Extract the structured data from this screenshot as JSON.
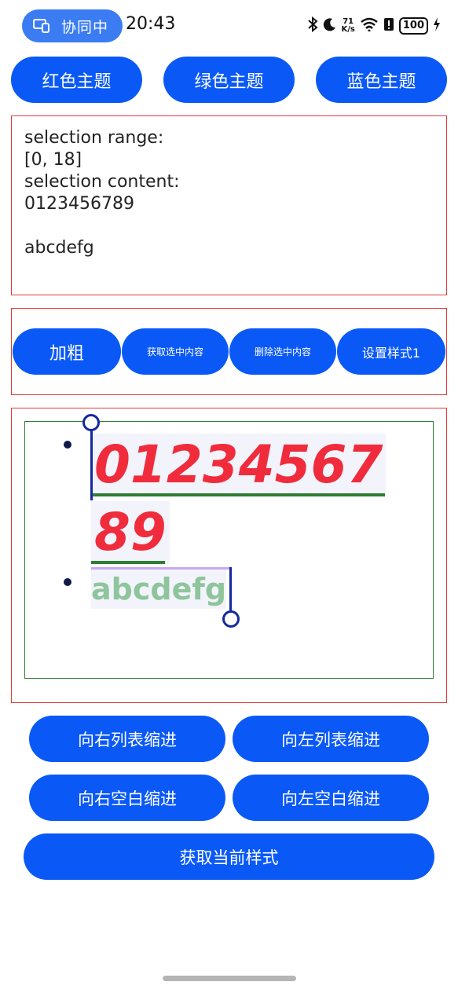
{
  "status_bar": {
    "collab_label": "协同中",
    "time": "20:43",
    "net_speed_value": "71",
    "net_speed_unit": "K/s",
    "battery": "100"
  },
  "theme_buttons": {
    "red": "红色主题",
    "green": "绿色主题",
    "blue": "蓝色主题"
  },
  "selection_info": {
    "text": "selection range:\n[0, 18]\nselection content:\n0123456789\n\nabcdefg"
  },
  "action_buttons": {
    "bold": "加粗",
    "get_selected": "获取选中内容",
    "delete_selected": "删除选中内容",
    "set_style": "设置样式1"
  },
  "editor": {
    "line1_part1": "01234567",
    "line1_part2": "89",
    "line2": "abcdefg"
  },
  "bottom_buttons": {
    "list_indent_right": "向右列表缩进",
    "list_indent_left": "向左列表缩进",
    "space_indent_right": "向右空白缩进",
    "space_indent_left": "向左空白缩进",
    "get_current_style": "获取当前样式"
  },
  "colors": {
    "button_blue": "#0a59f7",
    "frame_red": "#e53935",
    "frame_green": "#2e7d32",
    "number_red": "#f02c3c",
    "abc_green": "#8ec59c",
    "handle_blue": "#1428a0"
  }
}
